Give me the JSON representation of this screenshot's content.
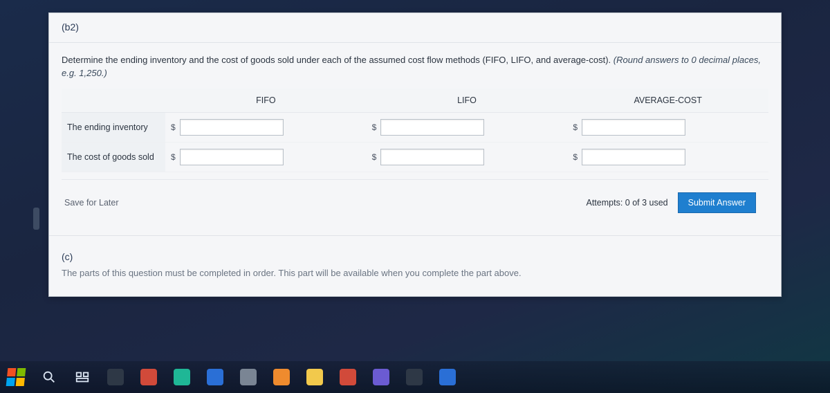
{
  "part_b_label": "(b2)",
  "prompt_main": "Determine the ending inventory and the cost of goods sold under each of the assumed cost flow methods (FIFO, LIFO, and average-cost).",
  "prompt_hint": "(Round answers to 0 decimal places, e.g. 1,250.)",
  "columns": [
    "FIFO",
    "LIFO",
    "AVERAGE-COST"
  ],
  "rows": [
    {
      "label": "The ending inventory"
    },
    {
      "label": "The cost of goods sold"
    }
  ],
  "currency_symbol": "$",
  "save_later": "Save for Later",
  "attempts_text": "Attempts: 0 of 3 used",
  "submit_label": "Submit Answer",
  "part_c_label": "(c)",
  "part_c_text": "The parts of this question must be completed in order. This part will be available when you complete the part above."
}
